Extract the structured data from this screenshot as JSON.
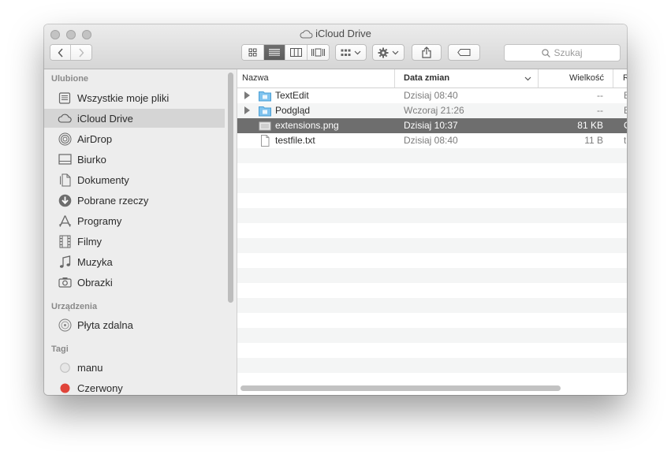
{
  "window": {
    "title": "iCloud Drive"
  },
  "toolbar": {
    "back_label": "‹",
    "forward_label": "›",
    "view_modes": [
      "icon-view",
      "list-view",
      "column-view",
      "cover-flow-view"
    ],
    "active_view": "list-view",
    "search_placeholder": "Szukaj"
  },
  "sidebar": {
    "favorites_header": "Ulubione",
    "favorites": [
      {
        "label": "Wszystkie moje pliki",
        "icon": "all-files-icon"
      },
      {
        "label": "iCloud Drive",
        "icon": "cloud-icon",
        "selected": true
      },
      {
        "label": "AirDrop",
        "icon": "airdrop-icon"
      },
      {
        "label": "Biurko",
        "icon": "desktop-icon"
      },
      {
        "label": "Dokumenty",
        "icon": "documents-icon"
      },
      {
        "label": "Pobrane rzeczy",
        "icon": "download-icon"
      },
      {
        "label": "Programy",
        "icon": "applications-icon"
      },
      {
        "label": "Filmy",
        "icon": "movies-icon"
      },
      {
        "label": "Muzyka",
        "icon": "music-icon"
      },
      {
        "label": "Obrazki",
        "icon": "pictures-icon"
      }
    ],
    "devices_header": "Urządzenia",
    "devices": [
      {
        "label": "Płyta zdalna",
        "icon": "remote-disc-icon"
      }
    ],
    "tags_header": "Tagi",
    "tags": [
      {
        "label": "manu",
        "color": "#d8d8d8"
      },
      {
        "label": "Czerwony",
        "color": "#e0443a"
      }
    ]
  },
  "filelist": {
    "columns": {
      "name": "Nazwa",
      "date": "Data zmian",
      "size": "Wielkość",
      "kind": "R"
    },
    "rows": [
      {
        "name": "TextEdit",
        "date": "Dzisiaj 08:40",
        "size": "--",
        "kind": "B",
        "type": "folder",
        "expandable": true
      },
      {
        "name": "Podgląd",
        "date": "Wczoraj 21:26",
        "size": "--",
        "kind": "B",
        "type": "folder",
        "expandable": true
      },
      {
        "name": "extensions.png",
        "date": "Dzisiaj 10:37",
        "size": "81 KB",
        "kind": "O",
        "type": "image",
        "selected": true
      },
      {
        "name": "testfile.txt",
        "date": "Dzisiaj 08:40",
        "size": "11 B",
        "kind": "t",
        "type": "text"
      }
    ]
  }
}
